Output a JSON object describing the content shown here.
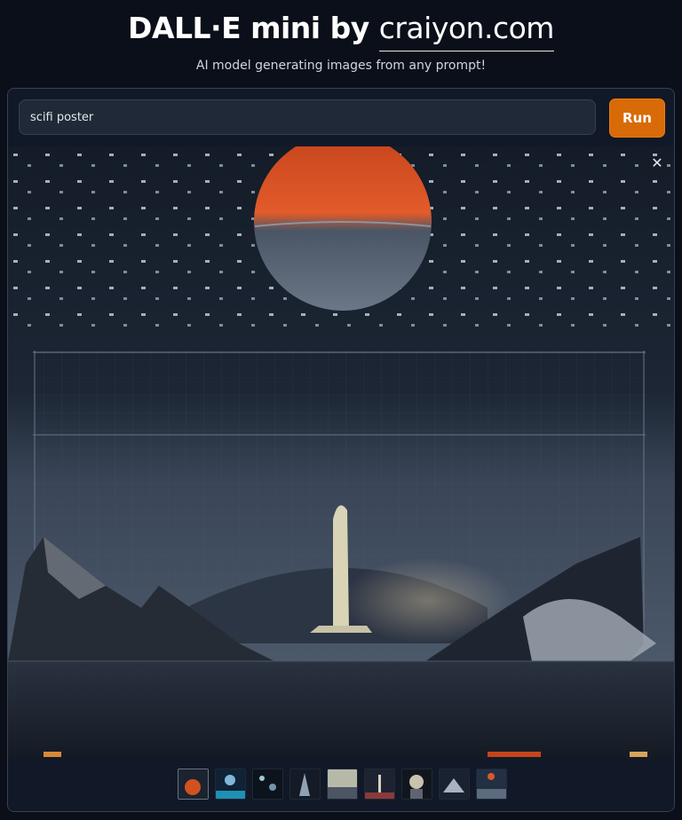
{
  "header": {
    "title_main": "DALL·E mini by ",
    "title_link": "craiyon.com",
    "subtitle": "AI model generating images from any prompt!"
  },
  "prompt": {
    "value": "scifi poster"
  },
  "run_button": {
    "label": "Run"
  },
  "gallery": {
    "close_icon": "close-icon",
    "thumbnail_count": 9,
    "selected_index": 0
  },
  "colors": {
    "background": "#0b0f19",
    "panel": "#111827",
    "accent": "#d86b08"
  }
}
